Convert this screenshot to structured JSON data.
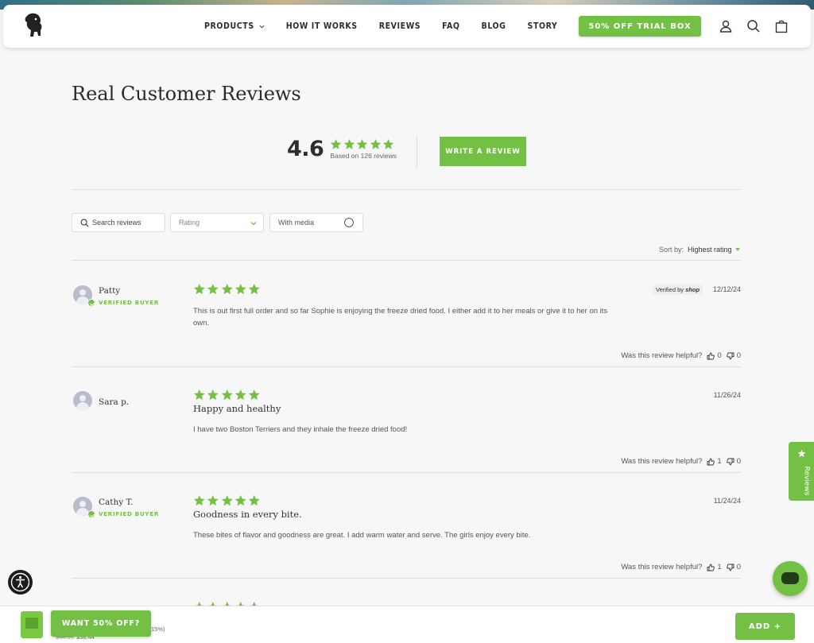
{
  "header": {
    "nav": [
      {
        "label": "PRODUCTS",
        "dropdown": true
      },
      {
        "label": "HOW IT WORKS"
      },
      {
        "label": "REVIEWS"
      },
      {
        "label": "FAQ"
      },
      {
        "label": "BLOG"
      },
      {
        "label": "STORY"
      }
    ],
    "cta_label": "50% OFF TRIAL BOX",
    "icons": [
      "account-icon",
      "search-icon",
      "cart-icon"
    ]
  },
  "page": {
    "title": "Real Customer Reviews"
  },
  "summary": {
    "average": "4.6",
    "stars": 5,
    "based_on": "Based on 126 reviews",
    "write_label": "WRITE A REVIEW"
  },
  "filters": {
    "search_label": "Search reviews",
    "rating_placeholder": "Rating",
    "media_label": "With media"
  },
  "sort": {
    "label": "Sort by:",
    "value": "Highest rating"
  },
  "reviews": [
    {
      "name": "Patty",
      "verified": "VERIFIED BUYER",
      "rating": 5,
      "title": "",
      "body": "This is out first full order and so far Sophie is enjoying the freeze dried food. I either add it to her meals or give it to her on its own.",
      "date": "12/12/24",
      "shop_badge": "Verified by",
      "shop_brand": "shop",
      "helpful_label": "Was this review helpful?",
      "up": "0",
      "down": "0"
    },
    {
      "name": "Sara p.",
      "verified": "",
      "rating": 5,
      "title": "Happy and healthy",
      "body": "I have two Boston Terriers and they inhale the freeze dried food!",
      "date": "11/26/24",
      "helpful_label": "Was this review helpful?",
      "up": "1",
      "down": "0"
    },
    {
      "name": "Cathy T.",
      "verified": "VERIFIED BUYER",
      "rating": 5,
      "title": "Goodness in every bite.",
      "body": "These bites of flavor and goodness are great. I add warm water and serve. The girls enjoy every bite.",
      "date": "11/24/24",
      "helpful_label": "Was this review helpful?",
      "up": "1",
      "down": "0"
    }
  ],
  "floating": {
    "reviews_tab": "Reviews"
  },
  "sticky_bar": {
    "product_name": "aw",
    "product_save": "ve 15%)",
    "price_old": "$44.99",
    "price_new": "$38.44",
    "want_label": "WANT 50% OFF?",
    "add_label": "ADD +"
  },
  "colors": {
    "accent": "#73c045",
    "background": "#f7f7f7",
    "text": "#333333"
  }
}
